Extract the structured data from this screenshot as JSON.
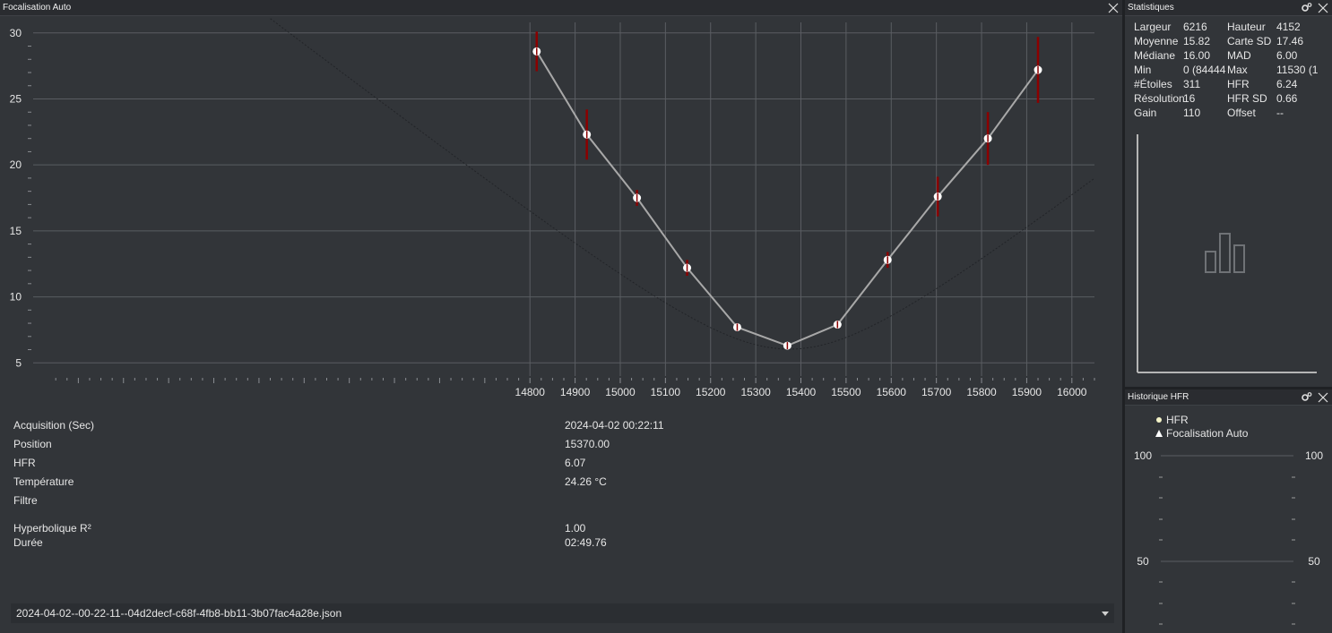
{
  "focus_panel": {
    "title": "Focalisation Auto",
    "info": [
      {
        "label": "Acquisition (Sec)",
        "value": "2024-04-02 00:22:11"
      },
      {
        "label": "Position",
        "value": "15370.00"
      },
      {
        "label": "HFR",
        "value": "6.07"
      },
      {
        "label": "Température",
        "value": "24.26 °C"
      },
      {
        "label": "Filtre",
        "value": ""
      },
      {
        "label": "Hyperbolique R²",
        "value": "1.00"
      },
      {
        "label": "Durée",
        "value": "02:49.76"
      }
    ],
    "file_select": {
      "value": "2024-04-02--00-22-11--04d2decf-c68f-4fb8-bb11-3b07fac4a28e.json"
    }
  },
  "chart_data": {
    "type": "scatter",
    "title": "",
    "xlabel": "",
    "ylabel": "",
    "xlim": [
      13700,
      16050
    ],
    "ylim": [
      4,
      30.8
    ],
    "xticks": [
      14800,
      14900,
      15000,
      15100,
      15200,
      15300,
      15400,
      15500,
      15600,
      15700,
      15800,
      15900,
      16000
    ],
    "yticks": [
      5,
      10,
      15,
      20,
      25,
      30
    ],
    "grid": true,
    "series": [
      {
        "type": "scatter-errorbar",
        "x": [
          14815,
          14926,
          15037,
          15148,
          15259,
          15370,
          15481,
          15592,
          15703,
          15814,
          15925
        ],
        "y": [
          28.6,
          22.3,
          17.5,
          12.2,
          7.7,
          6.3,
          7.9,
          12.8,
          17.6,
          22.0,
          27.2
        ],
        "err": [
          1.5,
          1.9,
          0.6,
          0.6,
          0.3,
          0.2,
          0.3,
          0.6,
          1.5,
          2.0,
          2.5
        ]
      },
      {
        "type": "fit-line",
        "x": [
          14815,
          14926,
          15037,
          15148,
          15259,
          15370,
          15481,
          15592,
          15703,
          15814,
          15925
        ],
        "y": [
          28.6,
          22.3,
          17.5,
          12.2,
          7.7,
          6.3,
          7.9,
          12.8,
          17.6,
          22.0,
          27.2
        ]
      }
    ],
    "colors": {
      "errorbar": "#8b0000",
      "line": "#a8a8a8",
      "point": "#ffffff",
      "grid": "#5a5d62"
    }
  },
  "stats_panel": {
    "title": "Statistiques",
    "rows": [
      {
        "l1": "Largeur",
        "v1": "6216",
        "l2": "Hauteur",
        "v2": "4152"
      },
      {
        "l1": "Moyenne",
        "v1": "15.82",
        "l2": "Carte SD",
        "v2": "17.46"
      },
      {
        "l1": "Médiane",
        "v1": "16.00",
        "l2": "MAD",
        "v2": "6.00"
      },
      {
        "l1": "Min",
        "v1": "0 (84444",
        "l2": "Max",
        "v2": "11530 (1"
      },
      {
        "l1": "#Étoiles",
        "v1": "311",
        "l2": "HFR",
        "v2": "6.24"
      },
      {
        "l1": "Résolution",
        "v1": "16",
        "l2": "HFR SD",
        "v2": "0.66"
      },
      {
        "l1": "Gain",
        "v1": "110",
        "l2": "Offset",
        "v2": "--"
      }
    ]
  },
  "hfr_panel": {
    "title": "Historique HFR",
    "legend": [
      {
        "label": "HFR",
        "marker": "dot"
      },
      {
        "label": "Focalisation Auto",
        "marker": "triangle"
      }
    ],
    "axis": {
      "left_ticks": [
        "100",
        "50"
      ],
      "right_ticks": [
        "100",
        "50"
      ]
    }
  }
}
